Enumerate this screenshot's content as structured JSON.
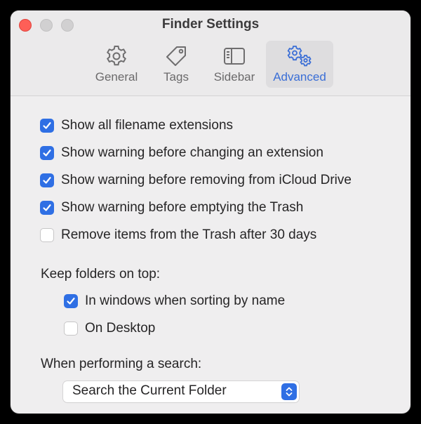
{
  "window": {
    "title": "Finder Settings"
  },
  "tabs": [
    {
      "label": "General",
      "icon": "gear-icon",
      "selected": false
    },
    {
      "label": "Tags",
      "icon": "tag-icon",
      "selected": false
    },
    {
      "label": "Sidebar",
      "icon": "sidebar-icon",
      "selected": false
    },
    {
      "label": "Advanced",
      "icon": "gears-icon",
      "selected": true
    }
  ],
  "options": {
    "show_extensions": {
      "label": "Show all filename extensions",
      "checked": true
    },
    "warn_change_extension": {
      "label": "Show warning before changing an extension",
      "checked": true
    },
    "warn_icloud_remove": {
      "label": "Show warning before removing from iCloud Drive",
      "checked": true
    },
    "warn_empty_trash": {
      "label": "Show warning before emptying the Trash",
      "checked": true
    },
    "remove_trash_30_days": {
      "label": "Remove items from the Trash after 30 days",
      "checked": false
    }
  },
  "keep_folders": {
    "heading": "Keep folders on top:",
    "windows": {
      "label": "In windows when sorting by name",
      "checked": true
    },
    "desktop": {
      "label": "On Desktop",
      "checked": false
    }
  },
  "search": {
    "heading": "When performing a search:",
    "selected": "Search the Current Folder"
  },
  "colors": {
    "accent": "#2f6fe4",
    "selected_tab_text": "#3a6ed6",
    "close_button": "#fe5f57"
  }
}
